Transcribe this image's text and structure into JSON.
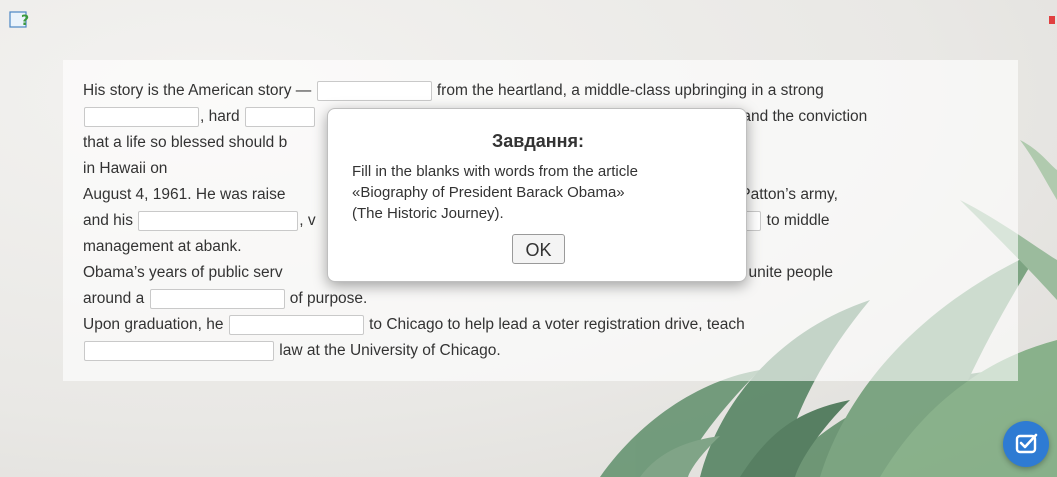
{
  "exercise": {
    "lines": [
      [
        {
          "t": "text",
          "v": "His story is the American story — "
        },
        {
          "t": "blank",
          "w": 115
        },
        {
          "t": "text",
          "v": " from the heartland, a middle-class upbringing in a strong"
        }
      ],
      [
        {
          "t": "blank",
          "w": 115
        },
        {
          "t": "text",
          "v": ", hard "
        },
        {
          "t": "blank",
          "w": 70
        },
        {
          "t": "text",
          "v": "                                                                                       ahead, and the conviction"
        }
      ],
      [
        {
          "t": "text",
          "v": "that a life so blessed should b"
        }
      ],
      [
        {
          "t": "text",
          "v": "in Hawaii on"
        }
      ],
      [
        {
          "t": "text",
          "v": "August 4, 1961. He was raise"
        },
        {
          "t": "text",
          "v": "                                                                                   ed in General Patton’s army,"
        }
      ],
      [
        {
          "t": "text",
          "v": "and his "
        },
        {
          "t": "blank",
          "w": 160
        },
        {
          "t": "text",
          "v": ", v"
        },
        {
          "t": "text",
          "v": "                                                                                       "
        },
        {
          "t": "blank",
          "w": 70
        },
        {
          "t": "text",
          "v": " to middle"
        }
      ],
      [
        {
          "t": "text",
          "v": "management at abank."
        }
      ],
      [
        {
          "t": "text",
          "v": "Obama’s years of public serv"
        },
        {
          "t": "text",
          "v": "                                                                                         he ability to unite people"
        }
      ],
      [
        {
          "t": "text",
          "v": "around a "
        },
        {
          "t": "blank",
          "w": 135
        },
        {
          "t": "text",
          "v": " of purpose."
        }
      ],
      [
        {
          "t": "text",
          "v": "Upon graduation, he "
        },
        {
          "t": "blank",
          "w": 135
        },
        {
          "t": "text",
          "v": " to Chicago to help lead a voter registration drive, teach"
        }
      ],
      [
        {
          "t": "blank",
          "w": 190
        },
        {
          "t": "text",
          "v": " law at the University of Chicago."
        }
      ]
    ]
  },
  "modal": {
    "title": "Завдання:",
    "body_lines": [
      "Fill in the blanks with words from the article",
      "«Biography of President Barack Obama»",
      "(The Historic Journey)."
    ],
    "ok_label": "OK"
  },
  "icons": {
    "help": "help-question-icon",
    "check": "check-submit-icon"
  },
  "colors": {
    "accent": "#2e7bd3"
  }
}
